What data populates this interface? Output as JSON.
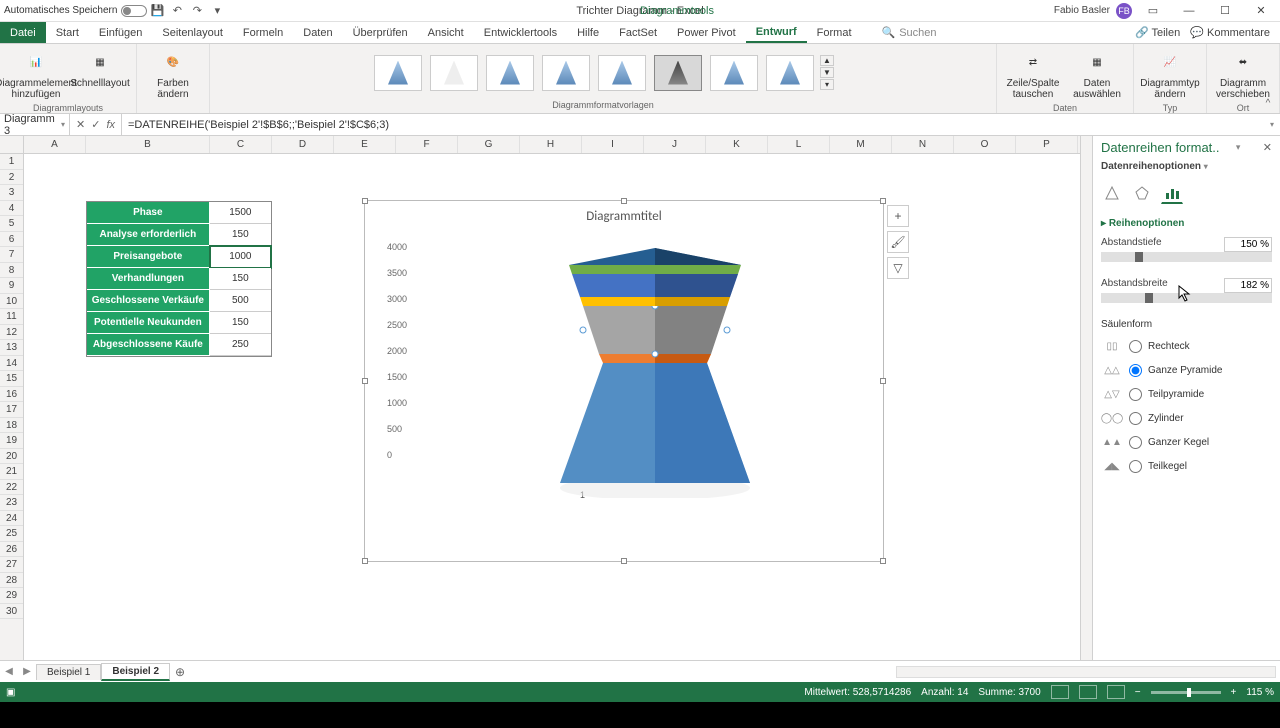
{
  "titlebar": {
    "autosave": "Automatisches Speichern",
    "doctitle": "Trichter Diagramm - Excel",
    "contexttab": "Diagrammtools",
    "user": "Fabio Basler",
    "avatar": "FB"
  },
  "ribbon_tabs": {
    "file": "Datei",
    "tabs": [
      "Start",
      "Einfügen",
      "Seitenlayout",
      "Formeln",
      "Daten",
      "Überprüfen",
      "Ansicht",
      "Entwicklertools",
      "Hilfe",
      "FactSet",
      "Power Pivot",
      "Entwurf",
      "Format"
    ],
    "active": "Entwurf",
    "search": "Suchen",
    "share": "Teilen",
    "comments": "Kommentare"
  },
  "ribbon": {
    "g1_btn1": "Diagrammelement hinzufügen",
    "g1_btn2": "Schnelllayout",
    "g1_label": "Diagrammlayouts",
    "g2_btn1": "Farben ändern",
    "g3_label": "Diagrammformatvorlagen",
    "g4_btn1": "Zeile/Spalte tauschen",
    "g4_btn2": "Daten auswählen",
    "g4_label": "Daten",
    "g5_btn1": "Diagrammtyp ändern",
    "g5_label": "Typ",
    "g6_btn1": "Diagramm verschieben",
    "g6_label": "Ort"
  },
  "formula": {
    "name": "Diagramm 3",
    "content": "=DATENREIHE('Beispiel 2'!$B$6;;'Beispiel 2'!$C$6;3)"
  },
  "columns": [
    "A",
    "B",
    "C",
    "D",
    "E",
    "F",
    "G",
    "H",
    "I",
    "J",
    "K",
    "L",
    "M",
    "N",
    "O",
    "P"
  ],
  "table": {
    "rows": [
      {
        "a": "Phase",
        "b": "1500"
      },
      {
        "a": "Analyse erforderlich",
        "b": "150"
      },
      {
        "a": "Preisangebote",
        "b": "1000"
      },
      {
        "a": "Verhandlungen",
        "b": "150"
      },
      {
        "a": "Geschlossene Verkäufe",
        "b": "500"
      },
      {
        "a": "Potentielle Neukunden",
        "b": "150"
      },
      {
        "a": "Abgeschlossene Käufe",
        "b": "250"
      }
    ]
  },
  "chart": {
    "title": "Diagrammtitel",
    "ticks": [
      "4000",
      "3500",
      "3000",
      "2500",
      "2000",
      "1500",
      "1000",
      "500",
      "0"
    ],
    "xcat": "1"
  },
  "chart_data": {
    "type": "bar",
    "subtype": "stacked-3d-pyramid",
    "categories": [
      "1"
    ],
    "series": [
      {
        "name": "Phase",
        "values": [
          1500
        ],
        "color": "#5b9bd5"
      },
      {
        "name": "Analyse erforderlich",
        "values": [
          150
        ],
        "color": "#ed7d31"
      },
      {
        "name": "Preisangebote",
        "values": [
          1000
        ],
        "color": "#a5a5a5"
      },
      {
        "name": "Verhandlungen",
        "values": [
          150
        ],
        "color": "#ffc000"
      },
      {
        "name": "Geschlossene Verkäufe",
        "values": [
          500
        ],
        "color": "#4472c4"
      },
      {
        "name": "Potentielle Neukunden",
        "values": [
          150
        ],
        "color": "#70ad47"
      },
      {
        "name": "Abgeschlossene Käufe",
        "values": [
          250
        ],
        "color": "#255e91"
      }
    ],
    "title": "Diagrammtitel",
    "xlabel": "",
    "ylabel": "",
    "ylim": [
      0,
      4000
    ]
  },
  "pane": {
    "title": "Datenreihen format..",
    "subtitle": "Datenreihenoptionen",
    "section": "Reihenoptionen",
    "prop1": "Abstandstiefe",
    "val1": "150 %",
    "prop2": "Abstandsbreite",
    "val2": "182 %",
    "shape_label": "Säulenform",
    "shapes": [
      "Rechteck",
      "Ganze Pyramide",
      "Teilpyramide",
      "Zylinder",
      "Ganzer Kegel",
      "Teilkegel"
    ],
    "shape_selected": 1
  },
  "sheets": {
    "tab1": "Beispiel 1",
    "tab2": "Beispiel 2"
  },
  "status": {
    "avg_label": "Mittelwert:",
    "avg": "528,5714286",
    "count_label": "Anzahl:",
    "count": "14",
    "sum_label": "Summe:",
    "sum": "3700",
    "zoom": "115 %"
  }
}
